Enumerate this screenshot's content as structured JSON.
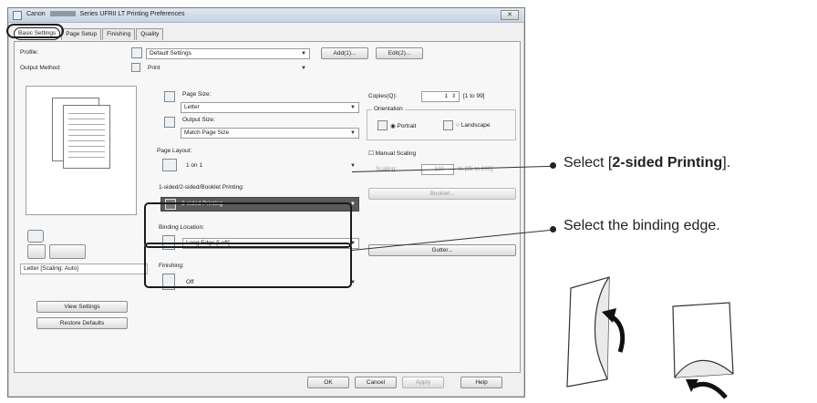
{
  "window": {
    "title_prefix": "Canon",
    "title_suffix": "Series UFRII LT Printing Preferences",
    "close_label": "✕"
  },
  "tabs": [
    {
      "label": "Basic Settings",
      "active": true
    },
    {
      "label": "Page Setup",
      "active": false
    },
    {
      "label": "Finishing",
      "active": false
    },
    {
      "label": "Quality",
      "active": false
    }
  ],
  "profile": {
    "label": "Profile:",
    "value": "Default Settings",
    "add_label": "Add(1)...",
    "edit_label": "Edit(2)..."
  },
  "output_method": {
    "label": "Output Method:",
    "value": "Print"
  },
  "page_size": {
    "label": "Page Size:",
    "value": "Letter"
  },
  "output_size": {
    "label": "Output Size:",
    "value": "Match Page Size"
  },
  "page_layout": {
    "label": "Page Layout:",
    "value": "1 on 1"
  },
  "copies": {
    "label": "Copies(Q):",
    "value": "1",
    "range": "[1 to 99]"
  },
  "orientation": {
    "label": "Orientation",
    "portrait": "Portrait",
    "landscape": "Landscape"
  },
  "manual_scaling": {
    "label": "Manual Scaling",
    "sub_label": "Scaling:",
    "value": "100",
    "range": "% [25 to 200]"
  },
  "booklet_button": "Booklet...",
  "duplex": {
    "label": "1-sided/2-sided/Booklet Printing:",
    "value": "2-sided Printing"
  },
  "binding": {
    "label": "Binding Location:",
    "value": "Long Edge [Left]",
    "gutter_label": "Gutter..."
  },
  "stapling": {
    "label": "Finishing:",
    "value": "Off"
  },
  "preview_caption": "Letter [Scaling: Auto]",
  "view_settings": "View Settings",
  "restore_defaults": "Restore Defaults",
  "footer": {
    "ok": "OK",
    "cancel": "Cancel",
    "apply": "Apply",
    "help": "Help"
  },
  "callouts": {
    "select_prefix": "Select [",
    "select_bold": "2-sided Printing",
    "select_suffix": "].",
    "binding_edge": "Select the binding edge."
  }
}
